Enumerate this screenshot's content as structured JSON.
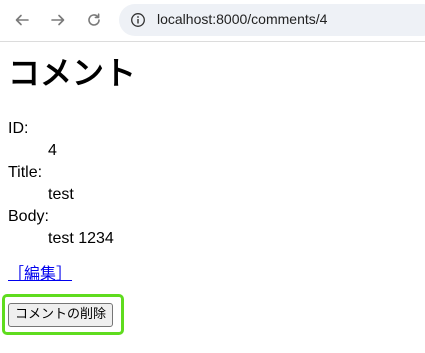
{
  "browser": {
    "url": "localhost:8000/comments/4"
  },
  "page": {
    "title": "コメント",
    "fields": [
      {
        "label": "ID:",
        "value": "4"
      },
      {
        "label": "Title:",
        "value": "test"
      },
      {
        "label": "Body:",
        "value": "test 1234"
      }
    ],
    "edit_link": "［編集］",
    "delete_button": "コメントの削除"
  },
  "colors": {
    "link": "#0000ee",
    "highlight": "#5fdc1e",
    "omnibox_bg": "#eef1f6"
  }
}
